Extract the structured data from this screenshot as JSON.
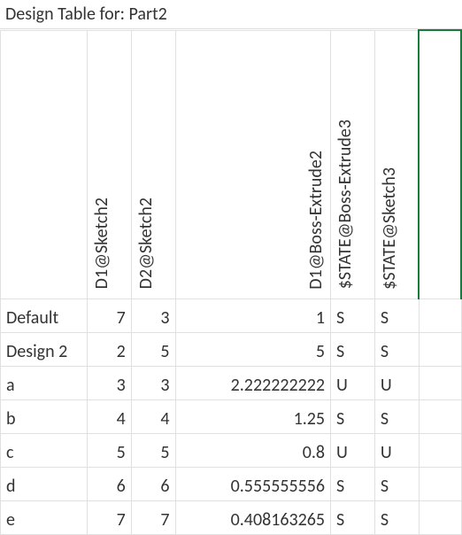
{
  "title": "Design Table for: Part2",
  "columns": [
    "D1@Sketch2",
    "D2@Sketch2",
    "D1@Boss-Extrude2",
    "$STATE@Boss-Extrude3",
    "$STATE@Sketch3"
  ],
  "rows": [
    {
      "name": "Default",
      "d1s2": 7,
      "d2s2": 3,
      "d1be2": "1",
      "st_be3": "S",
      "st_sk3": "S"
    },
    {
      "name": "Design 2",
      "d1s2": 2,
      "d2s2": 5,
      "d1be2": "5",
      "st_be3": "S",
      "st_sk3": "S"
    },
    {
      "name": "a",
      "d1s2": 3,
      "d2s2": 3,
      "d1be2": "2.222222222",
      "st_be3": "U",
      "st_sk3": "U"
    },
    {
      "name": "b",
      "d1s2": 4,
      "d2s2": 4,
      "d1be2": "1.25",
      "st_be3": "S",
      "st_sk3": "S"
    },
    {
      "name": "c",
      "d1s2": 5,
      "d2s2": 5,
      "d1be2": "0.8",
      "st_be3": "U",
      "st_sk3": "U"
    },
    {
      "name": "d",
      "d1s2": 6,
      "d2s2": 6,
      "d1be2": "0.555555556",
      "st_be3": "S",
      "st_sk3": "S"
    },
    {
      "name": "e",
      "d1s2": 7,
      "d2s2": 7,
      "d1be2": "0.408163265",
      "st_be3": "S",
      "st_sk3": "S"
    }
  ]
}
